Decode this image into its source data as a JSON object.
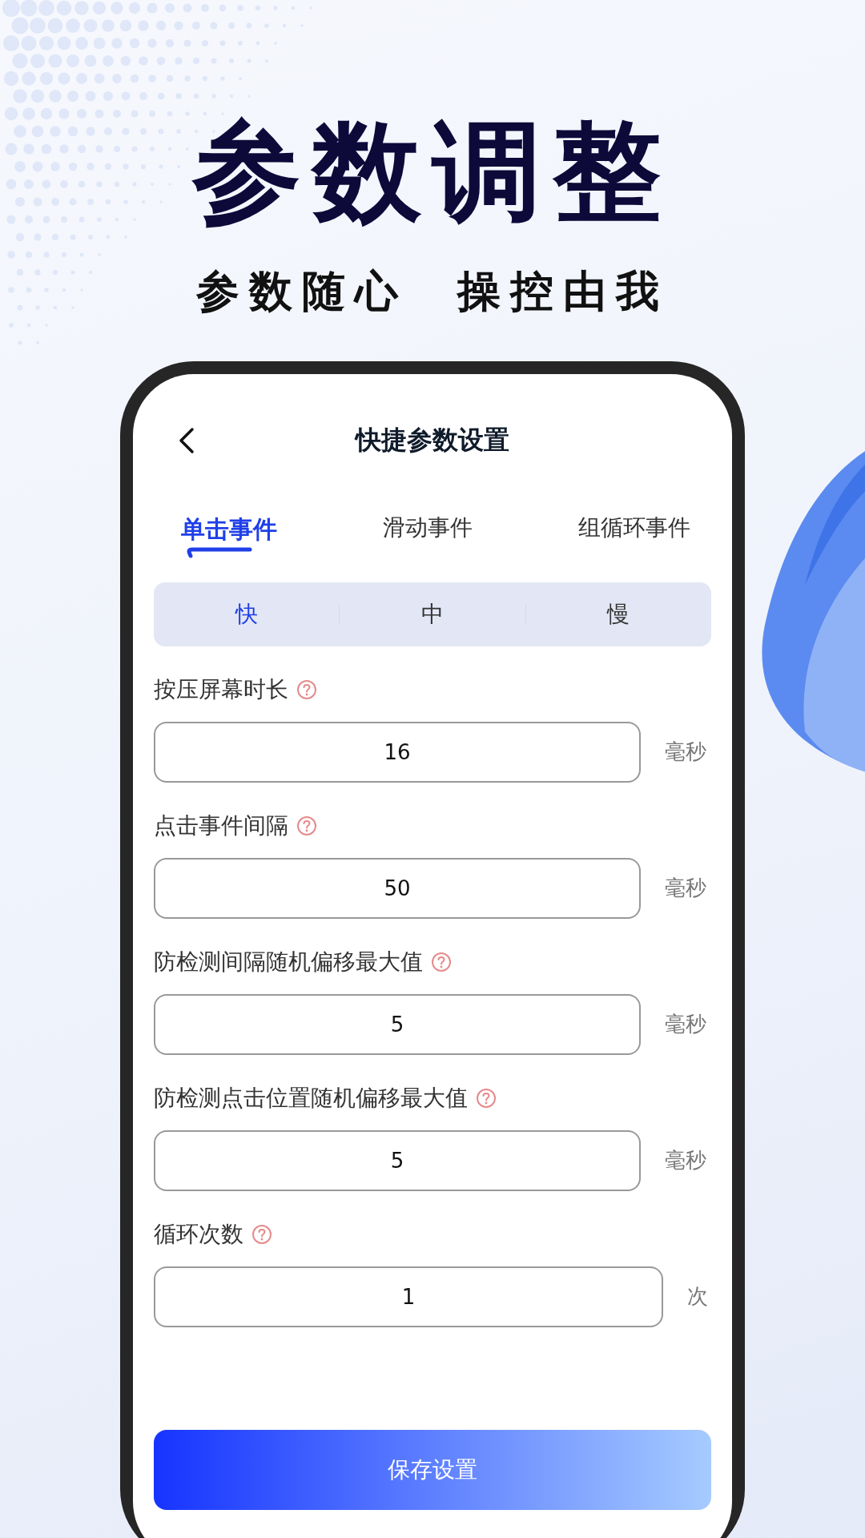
{
  "headline": "参数调整",
  "subheadline": "参数随心  操控由我",
  "screen": {
    "title": "快捷参数设置",
    "tabs": [
      {
        "label": "单击事件",
        "selected": true
      },
      {
        "label": "滑动事件",
        "selected": false
      },
      {
        "label": "组循环事件",
        "selected": false
      }
    ],
    "speeds": [
      {
        "label": "快",
        "selected": true
      },
      {
        "label": "中",
        "selected": false
      },
      {
        "label": "慢",
        "selected": false
      }
    ],
    "settings": [
      {
        "label": "按压屏幕时长",
        "value": "16",
        "unit": "毫秒"
      },
      {
        "label": "点击事件间隔",
        "value": "50",
        "unit": "毫秒"
      },
      {
        "label": "防检测间隔随机偏移最大值",
        "value": "5",
        "unit": "毫秒"
      },
      {
        "label": "防检测点击位置随机偏移最大值",
        "value": "5",
        "unit": "毫秒"
      },
      {
        "label": "循环次数",
        "value": "1",
        "unit": "次"
      }
    ],
    "save_button": "保存设置"
  }
}
